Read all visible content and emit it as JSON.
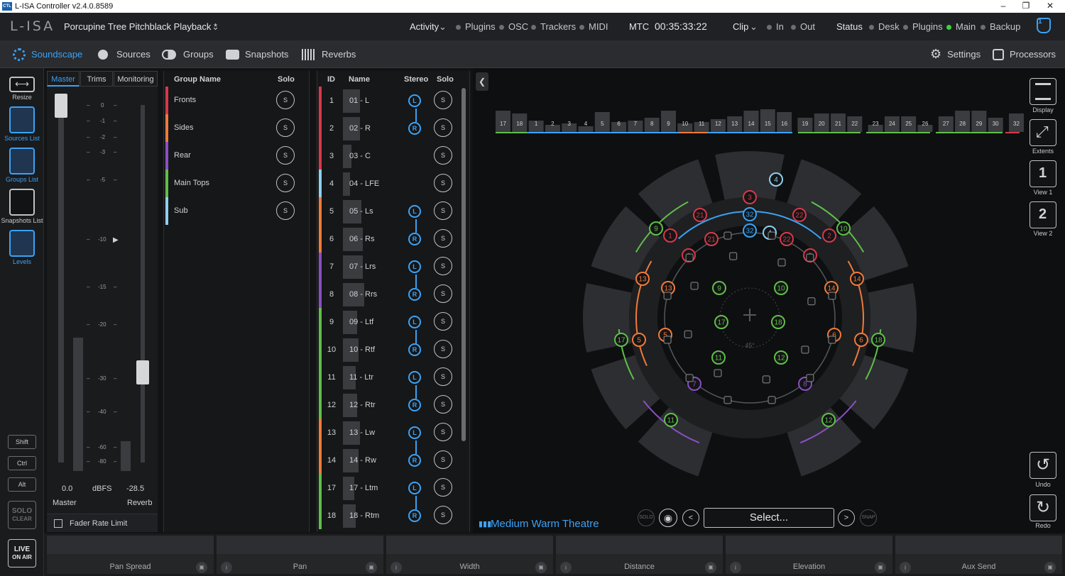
{
  "window": {
    "title": "L-ISA Controller v2.4.0.8589",
    "logo_text": "CTL"
  },
  "header": {
    "brand": "L-ISA",
    "project": "Porcupine Tree Pitchblack Playback *",
    "activity_label": "Activity",
    "activity_items": [
      "Plugins",
      "OSC",
      "Trackers",
      "MIDI"
    ],
    "mtc_label": "MTC",
    "timecode": "00:35:33:22",
    "clip_label": "Clip",
    "clip_items": [
      "In",
      "Out"
    ],
    "status_label": "Status",
    "status_items": [
      {
        "label": "Desk",
        "active": false
      },
      {
        "label": "Plugins",
        "active": false
      },
      {
        "label": "Main",
        "active": true
      },
      {
        "label": "Backup",
        "active": false
      }
    ],
    "notification_count": "1"
  },
  "nav": {
    "items": [
      "Soundscape",
      "Sources",
      "Groups",
      "Snapshots",
      "Reverbs"
    ],
    "active": "Soundscape",
    "right_items": [
      "Settings",
      "Processors"
    ]
  },
  "left_tools": {
    "resize": "Resize",
    "sources_list": "Sources List",
    "groups_list": "Groups List",
    "snapshots_list": "Snapshots List",
    "levels": "Levels",
    "shift": "Shift",
    "ctrl": "Ctrl",
    "alt": "Alt",
    "solo_clear_1": "SOLO",
    "solo_clear_2": "CLEAR",
    "live_1": "LIVE",
    "live_2": "ON AIR"
  },
  "master_panel": {
    "tabs": [
      "Master",
      "Trims",
      "Monitoring"
    ],
    "active_tab": "Master",
    "scale": [
      "0",
      "-1",
      "-2",
      "-3",
      "-5",
      "-10",
      "-15",
      "-20",
      "-30",
      "-40",
      "-60",
      "-80"
    ],
    "master_value": "0.0",
    "unit": "dBFS",
    "reverb_value": "-28.5",
    "master_label": "Master",
    "reverb_label": "Reverb",
    "fader_rate_limit": "Fader Rate Limit"
  },
  "groups": {
    "header_name": "Group Name",
    "header_solo": "Solo",
    "items": [
      {
        "name": "Fronts",
        "color": "#d8384a"
      },
      {
        "name": "Sides",
        "color": "#f07a3a"
      },
      {
        "name": "Rear",
        "color": "#8a4fc4"
      },
      {
        "name": "Main Tops",
        "color": "#5fbf4a"
      },
      {
        "name": "Sub",
        "color": "#8ed0f0"
      }
    ],
    "solo_symbol": "S"
  },
  "sources": {
    "header_id": "ID",
    "header_name": "Name",
    "header_stereo": "Stereo",
    "header_solo": "Solo",
    "rows": [
      {
        "id": "1",
        "name": "01 - L",
        "color": "#d8384a",
        "stereo": "L"
      },
      {
        "id": "2",
        "name": "02 - R",
        "color": "#d8384a",
        "stereo": "R"
      },
      {
        "id": "3",
        "name": "03 - C",
        "color": "#d8384a",
        "stereo": ""
      },
      {
        "id": "4",
        "name": "04 - LFE",
        "color": "#8ed0f0",
        "stereo": ""
      },
      {
        "id": "5",
        "name": "05 - Ls",
        "color": "#f07a3a",
        "stereo": "L"
      },
      {
        "id": "6",
        "name": "06 - Rs",
        "color": "#f07a3a",
        "stereo": "R"
      },
      {
        "id": "7",
        "name": "07 - Lrs",
        "color": "#8a4fc4",
        "stereo": "L"
      },
      {
        "id": "8",
        "name": "08 - Rrs",
        "color": "#8a4fc4",
        "stereo": "R"
      },
      {
        "id": "9",
        "name": "09 - Ltf",
        "color": "#5fbf4a",
        "stereo": "L"
      },
      {
        "id": "10",
        "name": "10 - Rtf",
        "color": "#5fbf4a",
        "stereo": "R"
      },
      {
        "id": "11",
        "name": "11 - Ltr",
        "color": "#5fbf4a",
        "stereo": "L"
      },
      {
        "id": "12",
        "name": "12 - Rtr",
        "color": "#5fbf4a",
        "stereo": "R"
      },
      {
        "id": "13",
        "name": "13 - Lw",
        "color": "#f07a3a",
        "stereo": "L"
      },
      {
        "id": "14",
        "name": "14 - Rw",
        "color": "#f07a3a",
        "stereo": "R"
      },
      {
        "id": "17",
        "name": "17 - Ltm",
        "color": "#5fbf4a",
        "stereo": "L"
      },
      {
        "id": "18",
        "name": "18 - Rtm",
        "color": "#5fbf4a",
        "stereo": "R"
      }
    ],
    "solo_symbol": "S"
  },
  "meters": {
    "labels": [
      "17",
      "18",
      "1",
      "2",
      "3",
      "4",
      "5",
      "6",
      "7",
      "8",
      "9",
      "10",
      "11",
      "12",
      "13",
      "14",
      "15",
      "16",
      "19",
      "20",
      "21",
      "22",
      "23",
      "24",
      "25",
      "26",
      "27",
      "28",
      "29",
      "30",
      "32"
    ]
  },
  "stage": {
    "room_name": "Medium Warm Theatre",
    "solo_btn": "SOLO",
    "select_label": "Select...",
    "prev": "<",
    "next": ">",
    "snap_btn": "SNAP",
    "angle_label": "45°"
  },
  "right_tools": [
    "Display",
    "Extents",
    "View 1",
    "View 2"
  ],
  "undo": "Undo",
  "redo": "Redo",
  "bottom_params": [
    "Pan Spread",
    "Pan",
    "Width",
    "Distance",
    "Elevation",
    "Aux Send"
  ],
  "info_symbol": "i",
  "colors": {
    "accent": "#3ba2f5",
    "red": "#d8384a",
    "orange": "#f07a3a",
    "purple": "#8a4fc4",
    "green": "#5fbf4a",
    "lightblue": "#8ed0f0"
  }
}
